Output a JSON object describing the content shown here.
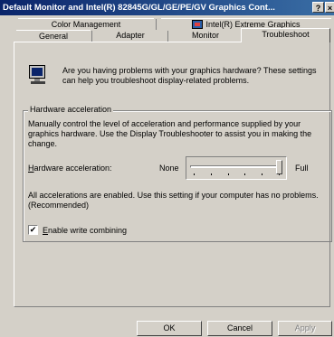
{
  "window": {
    "title": "Default Monitor and Intel(R) 82845G/GL/GE/PE/GV Graphics Cont...",
    "help_button": "?"
  },
  "tabs_back": [
    {
      "label": "Color Management"
    },
    {
      "label": "Intel(R) Extreme Graphics"
    }
  ],
  "tabs_front": [
    {
      "label": "General"
    },
    {
      "label": "Adapter"
    },
    {
      "label": "Monitor"
    },
    {
      "label": "Troubleshoot"
    }
  ],
  "troubleshoot": {
    "intro": "Are you having problems with your graphics hardware? These settings can help you troubleshoot display-related problems.",
    "group_title": "Hardware acceleration",
    "description": "Manually control the level of acceleration and performance supplied by your graphics hardware. Use the Display Troubleshooter to assist you in making the change.",
    "hw_label_prefix": "",
    "hw_label_hotkey": "H",
    "hw_label_rest": "ardware acceleration:",
    "slider_min_label": "None",
    "slider_max_label": "Full",
    "slider_level": 5,
    "slider_max": 5,
    "status_text": "All accelerations are enabled. Use this setting if your computer has no problems. (Recommended)",
    "write_combining_hotkey": "E",
    "write_combining_rest": "nable write combining",
    "write_combining_checked": true
  },
  "buttons": {
    "ok": "OK",
    "cancel": "Cancel",
    "apply": "Apply"
  },
  "colors": {
    "title_start": "#0a246a",
    "title_end": "#3a6ea5",
    "face": "#d4d0c8",
    "disabled_text": "#808080"
  }
}
